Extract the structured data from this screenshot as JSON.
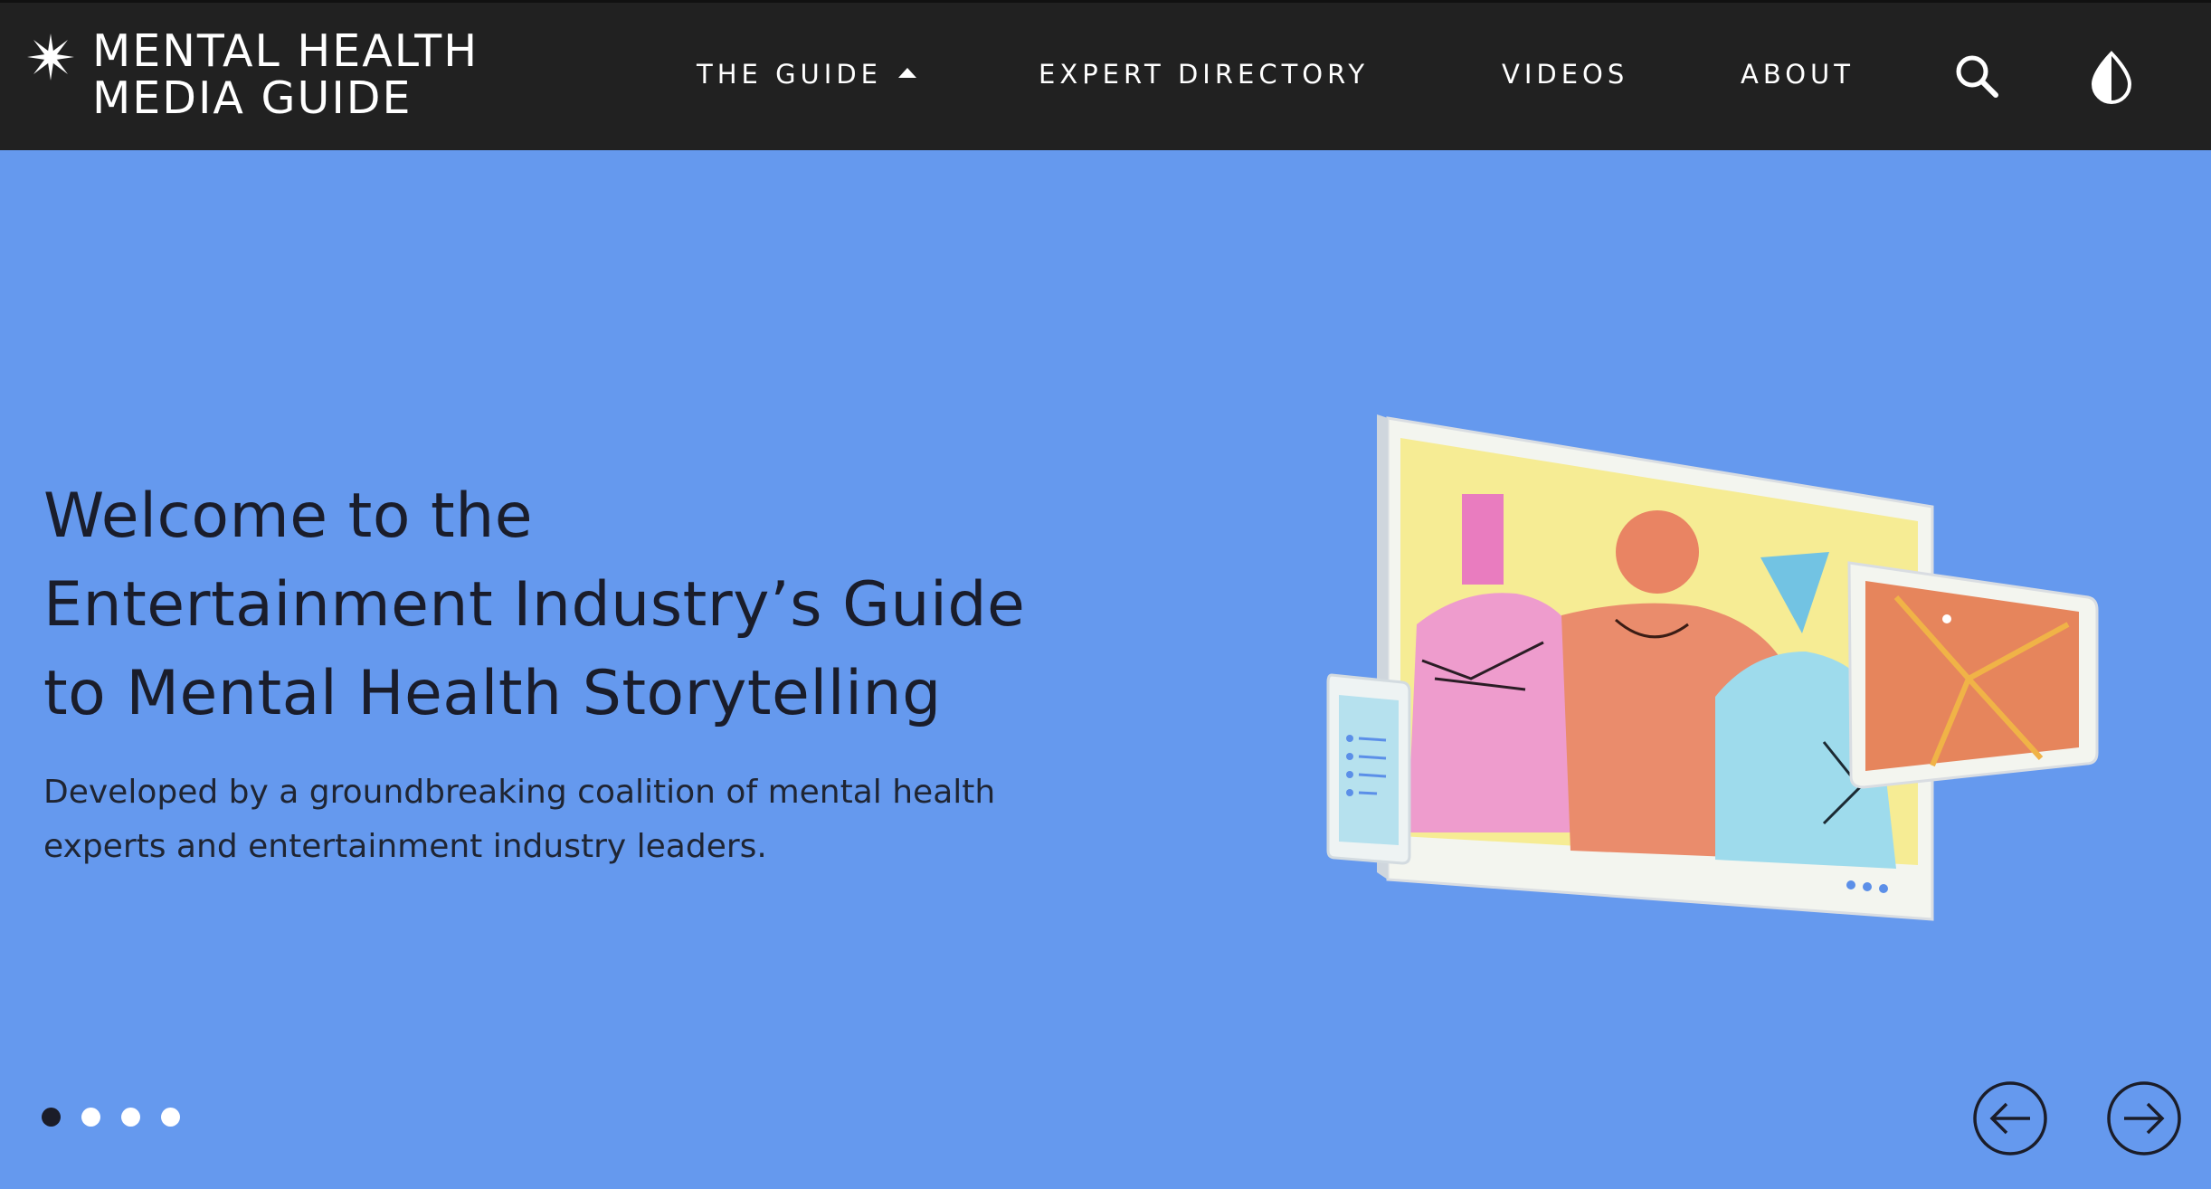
{
  "brand": {
    "name_line1": "MENTAL HEALTH",
    "name_line2": "MEDIA GUIDE",
    "icon": "asterisk-star-icon"
  },
  "nav": {
    "items": [
      {
        "label": "THE GUIDE",
        "has_dropdown": true,
        "icon": "caret-up-icon"
      },
      {
        "label": "EXPERT DIRECTORY"
      },
      {
        "label": "VIDEOS"
      },
      {
        "label": "ABOUT"
      }
    ],
    "search_icon": "search-icon",
    "contrast_icon": "contrast-drop-icon"
  },
  "hero": {
    "title_lines": [
      "Welcome to the",
      "Entertainment Industry’s Guide",
      "to Mental Health Storytelling"
    ],
    "subtitle_lines": [
      "Developed by a groundbreaking coalition of mental health",
      "experts and entertainment industry leaders."
    ],
    "illustration_icon": "video-call-illustration"
  },
  "carousel": {
    "slide_count": 4,
    "active_index": 0,
    "prev_icon": "arrow-left-circle-icon",
    "next_icon": "arrow-right-circle-icon"
  },
  "colors": {
    "nav_background": "#212121",
    "hero_background": "#6599ee",
    "text_dark": "#1a1d2b",
    "active_dot": "#1b1d29"
  }
}
